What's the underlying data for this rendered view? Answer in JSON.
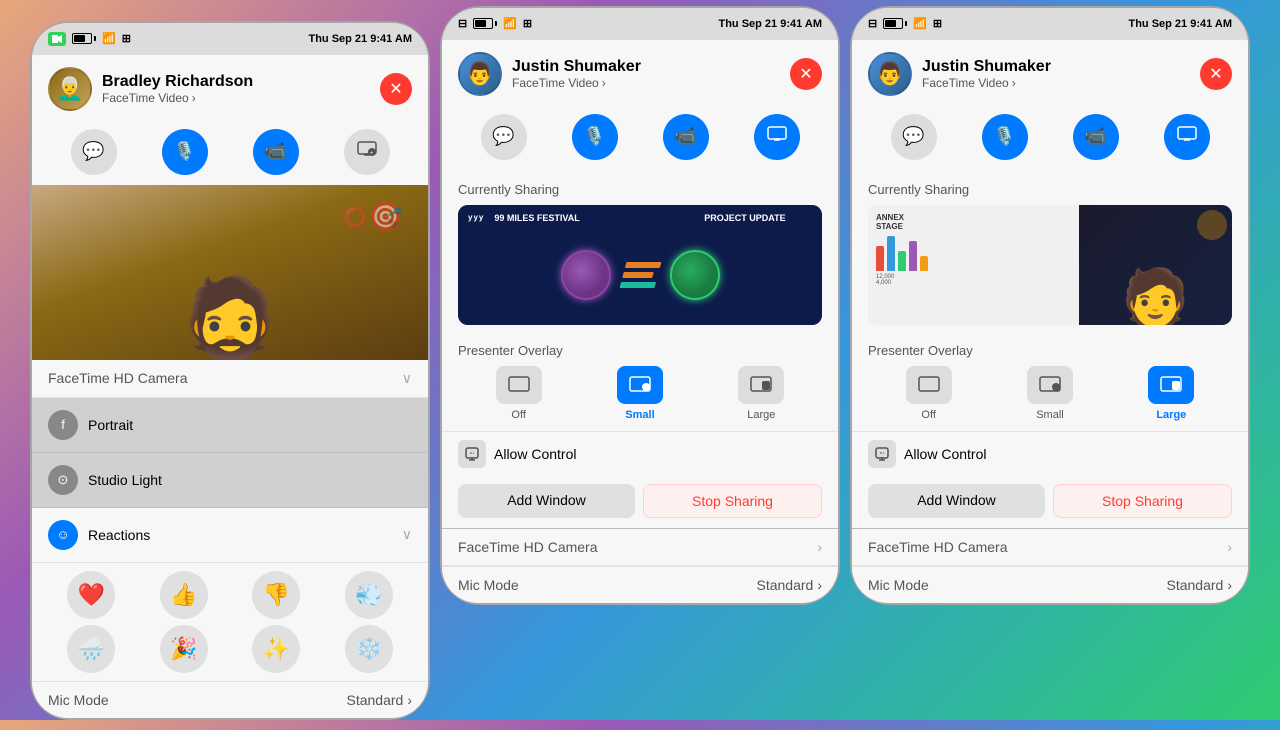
{
  "phones": [
    {
      "id": "phone1",
      "statusBar": {
        "time": "Thu Sep 21  9:41 AM",
        "hasFacetime": true
      },
      "caller": {
        "name": "Bradley Richardson",
        "subtitle": "FaceTime Video",
        "avatar": "👨‍🦳"
      },
      "controls": [
        "chat",
        "mic",
        "video",
        "screen"
      ],
      "videoFeed": true,
      "cameraLabel": "FaceTime HD Camera",
      "portrait": "Portrait",
      "studioLight": "Studio Light",
      "reactions": {
        "label": "Reactions",
        "expanded": true,
        "emojis": [
          "❤️",
          "👍",
          "👎",
          "💨",
          "🌧️",
          "🎉",
          "✨",
          "❄️"
        ]
      },
      "micMode": {
        "label": "Mic Mode",
        "value": "Standard"
      }
    },
    {
      "id": "phone2",
      "statusBar": {
        "time": "Thu Sep 21  9:41 AM",
        "hasFacetime": false
      },
      "caller": {
        "name": "Justin Shumaker",
        "subtitle": "FaceTime Video",
        "avatar": "👨"
      },
      "controls": [
        "chat",
        "mic",
        "video",
        "screen"
      ],
      "currentlySharing": "Currently Sharing",
      "sharing": {
        "type": "festival",
        "title1": "99 MILES FESTIVAL",
        "title2": "PROJECT UPDATE"
      },
      "presenterOverlay": {
        "label": "Presenter Overlay",
        "options": [
          "Off",
          "Small",
          "Large"
        ],
        "active": "Small"
      },
      "allowControl": "Allow Control",
      "addWindow": "Add Window",
      "stopSharing": "Stop Sharing",
      "cameraLabel": "FaceTime HD Camera",
      "micMode": {
        "label": "Mic Mode",
        "value": "Standard"
      }
    },
    {
      "id": "phone3",
      "statusBar": {
        "time": "Thu Sep 21  9:41 AM",
        "hasFacetime": false
      },
      "caller": {
        "name": "Justin Shumaker",
        "subtitle": "FaceTime Video",
        "avatar": "👨"
      },
      "controls": [
        "chat",
        "mic",
        "video",
        "screen"
      ],
      "currentlySharing": "Currently Sharing",
      "sharing": {
        "type": "annex"
      },
      "presenterOverlay": {
        "label": "Presenter Overlay",
        "options": [
          "Off",
          "Small",
          "Large"
        ],
        "active": "Large"
      },
      "allowControl": "Allow Control",
      "addWindow": "Add Window",
      "stopSharing": "Stop Sharing",
      "cameraLabel": "FaceTime HD Camera",
      "micMode": {
        "label": "Mic Mode",
        "value": "Standard"
      }
    }
  ],
  "icons": {
    "chat": "💬",
    "mic": "🎤",
    "video": "📹",
    "screen": "🖥️",
    "close": "✕",
    "chevronDown": "›",
    "chevronRight": "›"
  }
}
